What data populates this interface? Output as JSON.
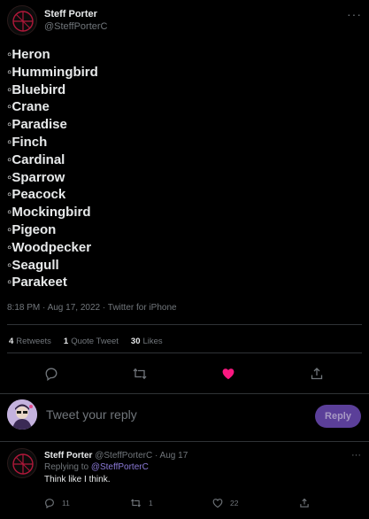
{
  "tweet": {
    "display_name": "Steff Porter",
    "handle": "@SteffPorterC",
    "more_label": "···",
    "items": [
      "◦Heron",
      "◦Hummingbird",
      "◦Bluebird",
      "◦Crane",
      "◦Paradise",
      "◦Finch",
      "◦Cardinal",
      "◦Sparrow",
      "◦Peacock",
      "◦Mockingbird",
      "◦Pigeon",
      "◦Woodpecker",
      "◦Seagull",
      "◦Parakeet"
    ],
    "meta": "8:18 PM · Aug 17, 2022 · Twitter for iPhone"
  },
  "stats": {
    "retweets_count": "4",
    "retweets_label": "Retweets",
    "quotes_count": "1",
    "quotes_label": "Quote Tweet",
    "likes_count": "30",
    "likes_label": "Likes"
  },
  "actions": {
    "icons": [
      "reply-icon",
      "retweet-icon",
      "like-icon",
      "share-icon"
    ],
    "like_color": "#f91880",
    "icon_color": "#71767b"
  },
  "reply_box": {
    "placeholder": "Tweet your reply",
    "button_label": "Reply",
    "button_color": "#5b3f99"
  },
  "reply": {
    "display_name": "Steff Porter",
    "handle_date": "@SteffPorterC · Aug 17",
    "replying_prefix": "Replying to",
    "replying_to": "@SteffPorterC",
    "text": "Think like I think.",
    "more_label": "···",
    "reply_count": "11",
    "retweet_count": "1",
    "like_count": "22"
  },
  "colors": {
    "background": "#000000",
    "accent": "#8b7ad8",
    "divider": "#2f3336"
  }
}
